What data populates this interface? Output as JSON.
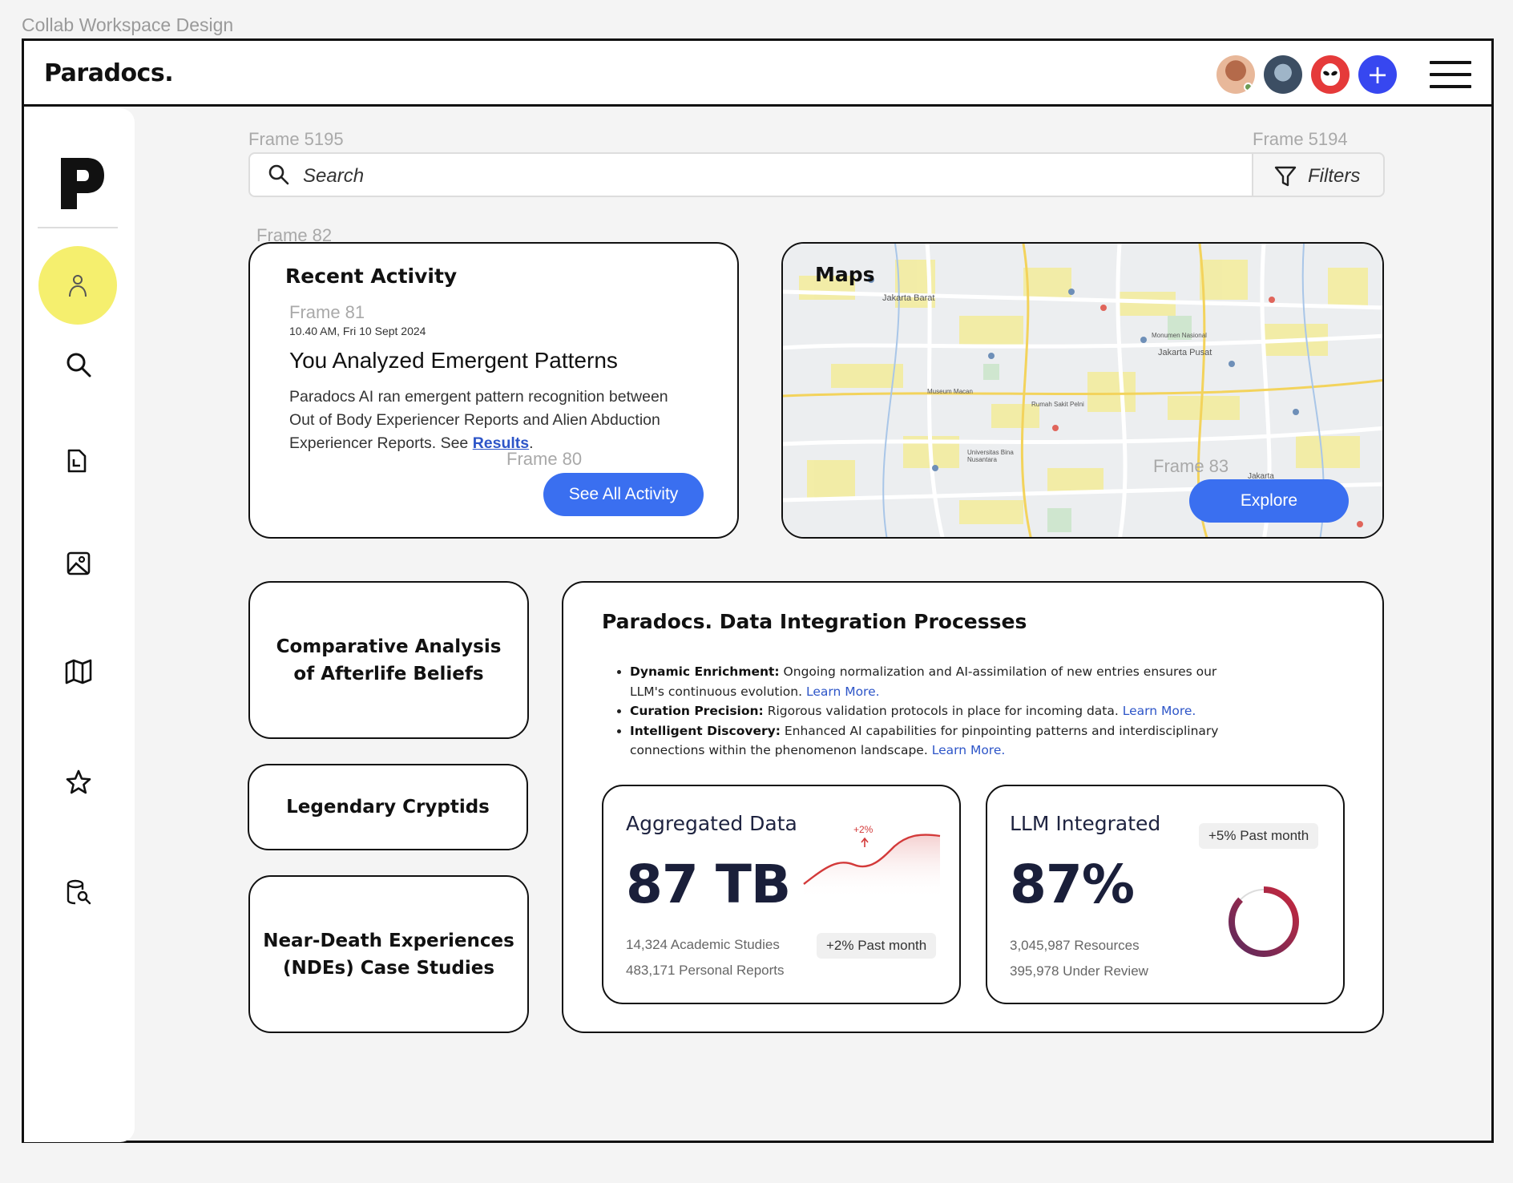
{
  "canvas": {
    "title": "Collab Workspace Design"
  },
  "frames": {
    "search": "Frame 5195",
    "filters": "Frame 5194",
    "cards": "Frame 82",
    "activity_item": "Frame 81",
    "activity_button": "Frame 80",
    "map_button": "Frame 83"
  },
  "topbar": {
    "logo": "Paradocs.",
    "avatars": [
      "user-avatar-1",
      "user-avatar-2",
      "user-avatar-alien"
    ],
    "add_label": "+"
  },
  "sidebar": {
    "items": [
      "profile-icon",
      "search-icon",
      "document-icon",
      "image-icon",
      "map-icon",
      "star-icon",
      "database-search-icon"
    ],
    "active": "profile-icon",
    "active_color": "#f5ef6e"
  },
  "search": {
    "placeholder": "Search",
    "filters_label": "Filters"
  },
  "recent_activity": {
    "title": "Recent Activity",
    "timestamp": "10.40 AM, Fri 10 Sept 2024",
    "heading": "You Analyzed Emergent Patterns",
    "body": "Paradocs AI ran emergent pattern recognition between Out of Body Experiencer Reports and Alien Abduction Experiencer Reports. See ",
    "link": "Results",
    "body_end": ".",
    "button": "See All Activity"
  },
  "maps": {
    "title": "Maps",
    "button": "Explore",
    "labels": [
      "Jakarta Barat",
      "Jakarta Pusat",
      "Monumen Nasional",
      "Rumah Sakit Pelni",
      "Museum Macan",
      "Universitas Bina Nusantara",
      "Jakarta"
    ]
  },
  "topics": [
    {
      "line1": "Comparative Analysis",
      "line2": "of Afterlife Beliefs"
    },
    {
      "line1": "Legendary Cryptids",
      "line2": ""
    },
    {
      "line1": "Near-Death Experiences",
      "line2": "(NDEs) Case Studies"
    }
  ],
  "integration": {
    "title": "Paradocs. Data Integration Processes",
    "bullets": [
      {
        "term": "Dynamic Enrichment:",
        "text": " Ongoing normalization and AI-assimilation of new entries ensures our LLM's continuous evolution. ",
        "link": "Learn More."
      },
      {
        "term": "Curation Precision:",
        "text": " Rigorous validation protocols in place for incoming data. ",
        "link": "Learn More."
      },
      {
        "term": "Intelligent Discovery:",
        "text": " Enhanced AI capabilities for pinpointing patterns and interdisciplinary connections within the phenomenon landscape. ",
        "link": "Learn More."
      }
    ],
    "link_color": "#2d55c8"
  },
  "stats": {
    "aggregated": {
      "label": "Aggregated Data",
      "value": "87 TB",
      "trend_label": "+2%",
      "line1": "14,324 Academic Studies",
      "line2": "483,171 Personal Reports",
      "chip": "+2% Past month"
    },
    "llm": {
      "label": "LLM Integrated",
      "value": "87%",
      "chip": "+5% Past month",
      "line1": "3,045,987 Resources",
      "line2": "395,978 Under Review",
      "progress": 0.87
    }
  },
  "colors": {
    "accent_blue": "#3a6ff0",
    "add_blue": "#3747f0",
    "trend_red": "#d33a3a"
  }
}
